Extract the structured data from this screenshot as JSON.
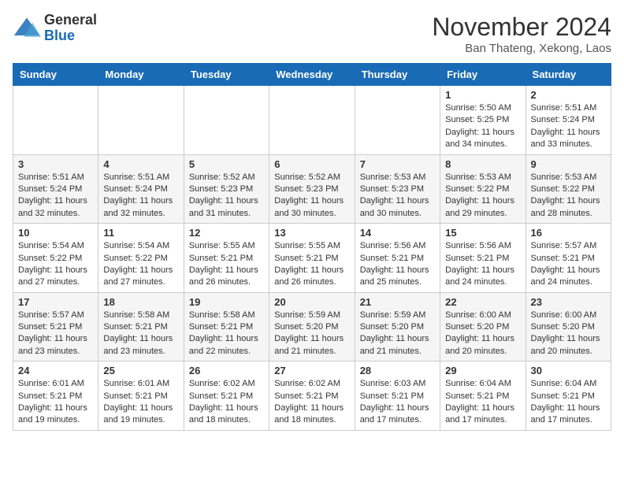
{
  "header": {
    "logo_general": "General",
    "logo_blue": "Blue",
    "month_title": "November 2024",
    "location": "Ban Thateng, Xekong, Laos"
  },
  "days_of_week": [
    "Sunday",
    "Monday",
    "Tuesday",
    "Wednesday",
    "Thursday",
    "Friday",
    "Saturday"
  ],
  "weeks": [
    [
      {
        "day": "",
        "info": ""
      },
      {
        "day": "",
        "info": ""
      },
      {
        "day": "",
        "info": ""
      },
      {
        "day": "",
        "info": ""
      },
      {
        "day": "",
        "info": ""
      },
      {
        "day": "1",
        "info": "Sunrise: 5:50 AM\nSunset: 5:25 PM\nDaylight: 11 hours and 34 minutes."
      },
      {
        "day": "2",
        "info": "Sunrise: 5:51 AM\nSunset: 5:24 PM\nDaylight: 11 hours and 33 minutes."
      }
    ],
    [
      {
        "day": "3",
        "info": "Sunrise: 5:51 AM\nSunset: 5:24 PM\nDaylight: 11 hours and 32 minutes."
      },
      {
        "day": "4",
        "info": "Sunrise: 5:51 AM\nSunset: 5:24 PM\nDaylight: 11 hours and 32 minutes."
      },
      {
        "day": "5",
        "info": "Sunrise: 5:52 AM\nSunset: 5:23 PM\nDaylight: 11 hours and 31 minutes."
      },
      {
        "day": "6",
        "info": "Sunrise: 5:52 AM\nSunset: 5:23 PM\nDaylight: 11 hours and 30 minutes."
      },
      {
        "day": "7",
        "info": "Sunrise: 5:53 AM\nSunset: 5:23 PM\nDaylight: 11 hours and 30 minutes."
      },
      {
        "day": "8",
        "info": "Sunrise: 5:53 AM\nSunset: 5:22 PM\nDaylight: 11 hours and 29 minutes."
      },
      {
        "day": "9",
        "info": "Sunrise: 5:53 AM\nSunset: 5:22 PM\nDaylight: 11 hours and 28 minutes."
      }
    ],
    [
      {
        "day": "10",
        "info": "Sunrise: 5:54 AM\nSunset: 5:22 PM\nDaylight: 11 hours and 27 minutes."
      },
      {
        "day": "11",
        "info": "Sunrise: 5:54 AM\nSunset: 5:22 PM\nDaylight: 11 hours and 27 minutes."
      },
      {
        "day": "12",
        "info": "Sunrise: 5:55 AM\nSunset: 5:21 PM\nDaylight: 11 hours and 26 minutes."
      },
      {
        "day": "13",
        "info": "Sunrise: 5:55 AM\nSunset: 5:21 PM\nDaylight: 11 hours and 26 minutes."
      },
      {
        "day": "14",
        "info": "Sunrise: 5:56 AM\nSunset: 5:21 PM\nDaylight: 11 hours and 25 minutes."
      },
      {
        "day": "15",
        "info": "Sunrise: 5:56 AM\nSunset: 5:21 PM\nDaylight: 11 hours and 24 minutes."
      },
      {
        "day": "16",
        "info": "Sunrise: 5:57 AM\nSunset: 5:21 PM\nDaylight: 11 hours and 24 minutes."
      }
    ],
    [
      {
        "day": "17",
        "info": "Sunrise: 5:57 AM\nSunset: 5:21 PM\nDaylight: 11 hours and 23 minutes."
      },
      {
        "day": "18",
        "info": "Sunrise: 5:58 AM\nSunset: 5:21 PM\nDaylight: 11 hours and 23 minutes."
      },
      {
        "day": "19",
        "info": "Sunrise: 5:58 AM\nSunset: 5:21 PM\nDaylight: 11 hours and 22 minutes."
      },
      {
        "day": "20",
        "info": "Sunrise: 5:59 AM\nSunset: 5:20 PM\nDaylight: 11 hours and 21 minutes."
      },
      {
        "day": "21",
        "info": "Sunrise: 5:59 AM\nSunset: 5:20 PM\nDaylight: 11 hours and 21 minutes."
      },
      {
        "day": "22",
        "info": "Sunrise: 6:00 AM\nSunset: 5:20 PM\nDaylight: 11 hours and 20 minutes."
      },
      {
        "day": "23",
        "info": "Sunrise: 6:00 AM\nSunset: 5:20 PM\nDaylight: 11 hours and 20 minutes."
      }
    ],
    [
      {
        "day": "24",
        "info": "Sunrise: 6:01 AM\nSunset: 5:21 PM\nDaylight: 11 hours and 19 minutes."
      },
      {
        "day": "25",
        "info": "Sunrise: 6:01 AM\nSunset: 5:21 PM\nDaylight: 11 hours and 19 minutes."
      },
      {
        "day": "26",
        "info": "Sunrise: 6:02 AM\nSunset: 5:21 PM\nDaylight: 11 hours and 18 minutes."
      },
      {
        "day": "27",
        "info": "Sunrise: 6:02 AM\nSunset: 5:21 PM\nDaylight: 11 hours and 18 minutes."
      },
      {
        "day": "28",
        "info": "Sunrise: 6:03 AM\nSunset: 5:21 PM\nDaylight: 11 hours and 17 minutes."
      },
      {
        "day": "29",
        "info": "Sunrise: 6:04 AM\nSunset: 5:21 PM\nDaylight: 11 hours and 17 minutes."
      },
      {
        "day": "30",
        "info": "Sunrise: 6:04 AM\nSunset: 5:21 PM\nDaylight: 11 hours and 17 minutes."
      }
    ]
  ]
}
